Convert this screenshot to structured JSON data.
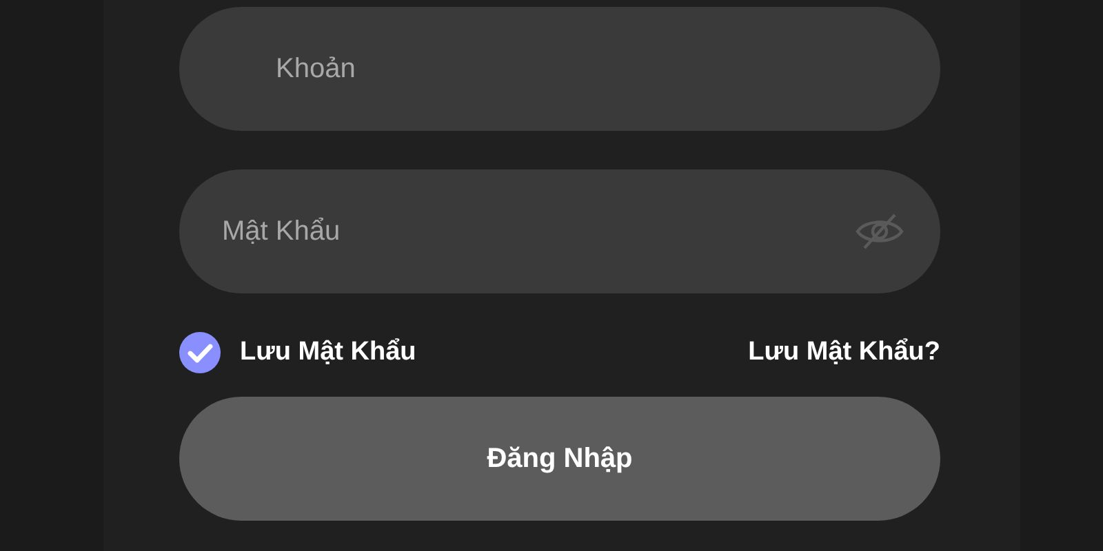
{
  "username_field": {
    "placeholder": "Khoản"
  },
  "password_field": {
    "placeholder": "Mật Khẩu",
    "password_visible": false
  },
  "remember": {
    "label": "Lưu Mật Khẩu",
    "checked": true
  },
  "forgot_link": "Lưu Mật Khẩu?",
  "login_button": "Đăng Nhập"
}
